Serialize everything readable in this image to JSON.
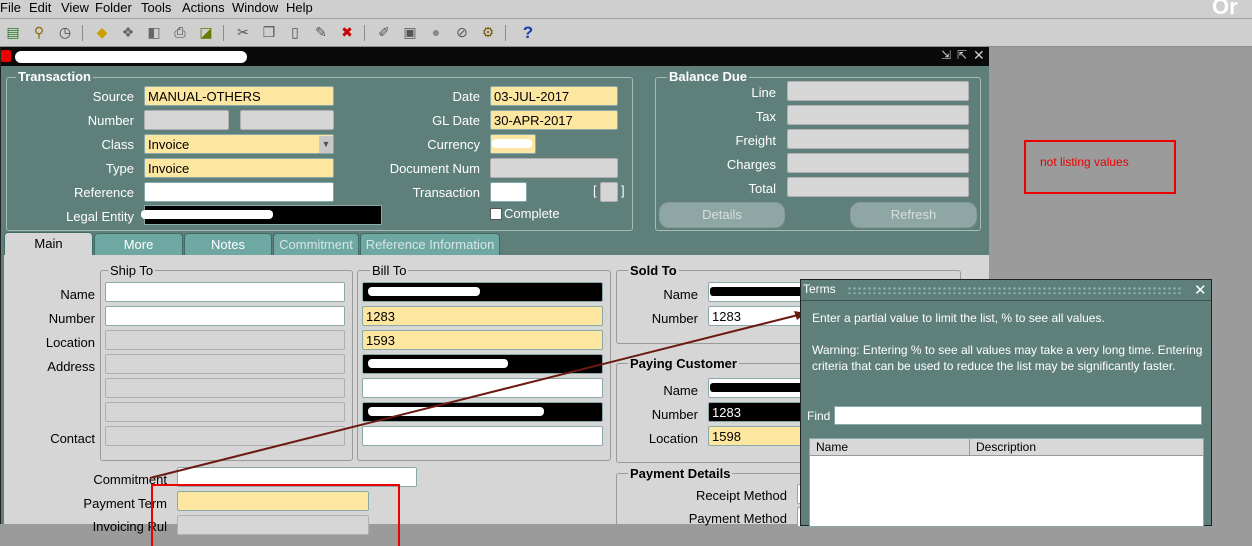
{
  "menu": {
    "items": [
      "File",
      "Edit",
      "View",
      "Folder",
      "Tools",
      "Actions",
      "Window",
      "Help"
    ],
    "brand": "Or"
  },
  "toolbar": {
    "icons": [
      "new-record-icon",
      "find-icon",
      "navigator-icon",
      "save-icon",
      "next-step-icon",
      "switch-responsibility-icon",
      "print-icon",
      "close-form-icon",
      "new-icon",
      "cut-icon",
      "copy-icon",
      "paste-icon",
      "clear-record-icon",
      "delete-record-icon",
      "edit-field-icon",
      "zoom-icon",
      "translations-icon",
      "attachments-icon",
      "folder-tools-icon",
      "help-icon"
    ],
    "help_glyph": "?"
  },
  "window": {
    "controls": [
      "⇲",
      "⇱",
      "✕"
    ]
  },
  "transaction": {
    "title": "Transaction",
    "source_label": "Source",
    "source_value": "MANUAL-OTHERS",
    "number_label": "Number",
    "class_label": "Class",
    "class_value": "Invoice",
    "type_label": "Type",
    "type_value": "Invoice",
    "reference_label": "Reference",
    "legal_entity_label": "Legal Entity",
    "date_label": "Date",
    "date_value": "03-JUL-2017",
    "gl_date_label": "GL Date",
    "gl_date_value": "30-APR-2017",
    "currency_label": "Currency",
    "document_num_label": "Document Num",
    "transaction_label": "Transaction",
    "complete_label": "Complete",
    "bracket_left": "[",
    "bracket_right": "]"
  },
  "balance_due": {
    "title": "Balance Due",
    "line_label": "Line",
    "tax_label": "Tax",
    "freight_label": "Freight",
    "charges_label": "Charges",
    "total_label": "Total",
    "details_button": "Details",
    "refresh_button": "Refresh"
  },
  "tabs": [
    "Main",
    "More",
    "Notes",
    "Commitment",
    "Reference Information"
  ],
  "ship_to": {
    "title": "Ship To",
    "name_label": "Name",
    "number_label": "Number",
    "location_label": "Location",
    "address_label": "Address",
    "contact_label": "Contact"
  },
  "bill_to": {
    "title": "Bill To",
    "number_value": "1283",
    "location_value": "1593"
  },
  "sold_to": {
    "title": "Sold To",
    "name_label": "Name",
    "number_label": "Number",
    "number_value": "1283"
  },
  "paying_customer": {
    "title": "Paying Customer",
    "name_label": "Name",
    "number_label": "Number",
    "number_value": "1283",
    "location_label": "Location",
    "location_value": "1598"
  },
  "payment_details": {
    "title": "Payment Details",
    "receipt_method_label": "Receipt Method",
    "payment_method_label": "Payment Method"
  },
  "bottom_fields": {
    "commitment_label": "Commitment",
    "payment_term_label": "Payment Term",
    "invoicing_rule_label": "Invoicing Rul"
  },
  "annotation": {
    "text": "not listing values",
    "color": "#e00000"
  },
  "lov": {
    "title": "Terms",
    "close": "✕",
    "hint": "Enter a partial value to limit the list, % to see all values.",
    "warning": "Warning: Entering % to see all values may take a very long time. Entering criteria that can be used to reduce the list may be significantly faster.",
    "find_label": "Find",
    "find_value": "",
    "columns": [
      "Name",
      "Description"
    ]
  }
}
